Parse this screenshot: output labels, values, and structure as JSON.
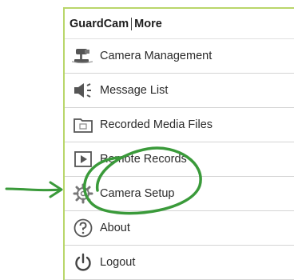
{
  "header": {
    "app_name": "GuardCam",
    "section": "More"
  },
  "menu": {
    "items": [
      {
        "label": "Camera Management",
        "icon": "camera-icon"
      },
      {
        "label": "Message List",
        "icon": "speaker-icon"
      },
      {
        "label": "Recorded Media Files",
        "icon": "folder-icon"
      },
      {
        "label": "Remote Records",
        "icon": "play-icon"
      },
      {
        "label": "Camera Setup",
        "icon": "gear-icon"
      },
      {
        "label": "About",
        "icon": "question-icon"
      },
      {
        "label": "Logout",
        "icon": "power-icon"
      }
    ]
  },
  "annotation": {
    "color": "#3a9a3a"
  }
}
